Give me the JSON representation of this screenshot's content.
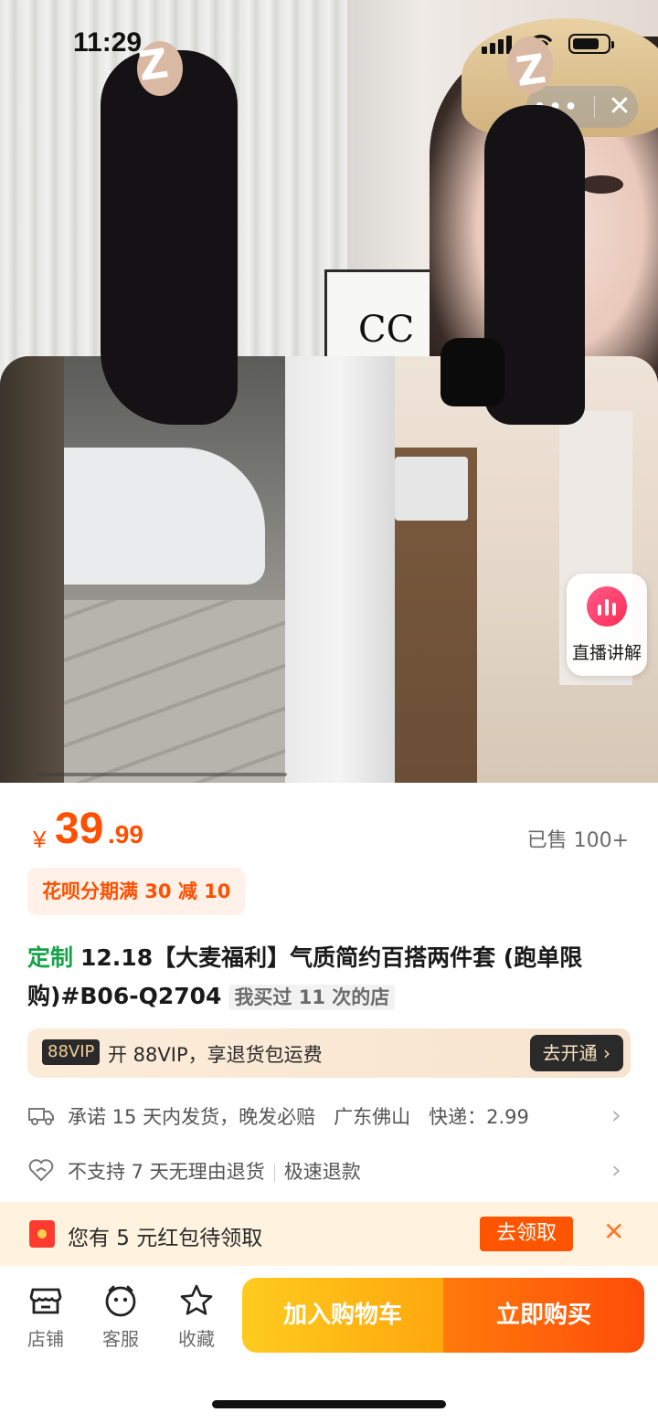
{
  "status_bar": {
    "time": "11:29"
  },
  "capsule": {
    "more": "•••",
    "close": "✕"
  },
  "live": {
    "label": "直播讲解"
  },
  "price": {
    "currency": "¥",
    "integer": "39",
    "decimal": ".99",
    "sold": "已售 100+"
  },
  "promo": {
    "tag": "花呗分期满 30 减 10"
  },
  "product": {
    "custom_tag": "定制",
    "title": "12.18【大麦福利】气质简约百搭两件套 (跑单限购)#B06-Q2704",
    "visited": "我买过 11 次的店"
  },
  "vip": {
    "badge": "88VIP",
    "text": "开 88VIP，享退货包运费",
    "button": "去开通 ›"
  },
  "shipping": {
    "promise": "承诺 15 天内发货，晚发必赔",
    "origin": "广东佛山",
    "express": "快递：2.99"
  },
  "returns": {
    "policy": "不支持 7 天无理由退货",
    "refund": "极速退款"
  },
  "coupon": {
    "text": "您有 5 元红包待领取",
    "button": "去领取",
    "close": "✕"
  },
  "bottom_nav": {
    "shop": "店铺",
    "service": "客服",
    "favorite": "收藏"
  },
  "actions": {
    "add_to_cart": "加入购物车",
    "buy_now": "立即购买"
  },
  "colors": {
    "price": "#ff4f00",
    "cart": "#ffa70d",
    "buy": "#ff4d0a",
    "custom_tag": "#16a34a"
  }
}
